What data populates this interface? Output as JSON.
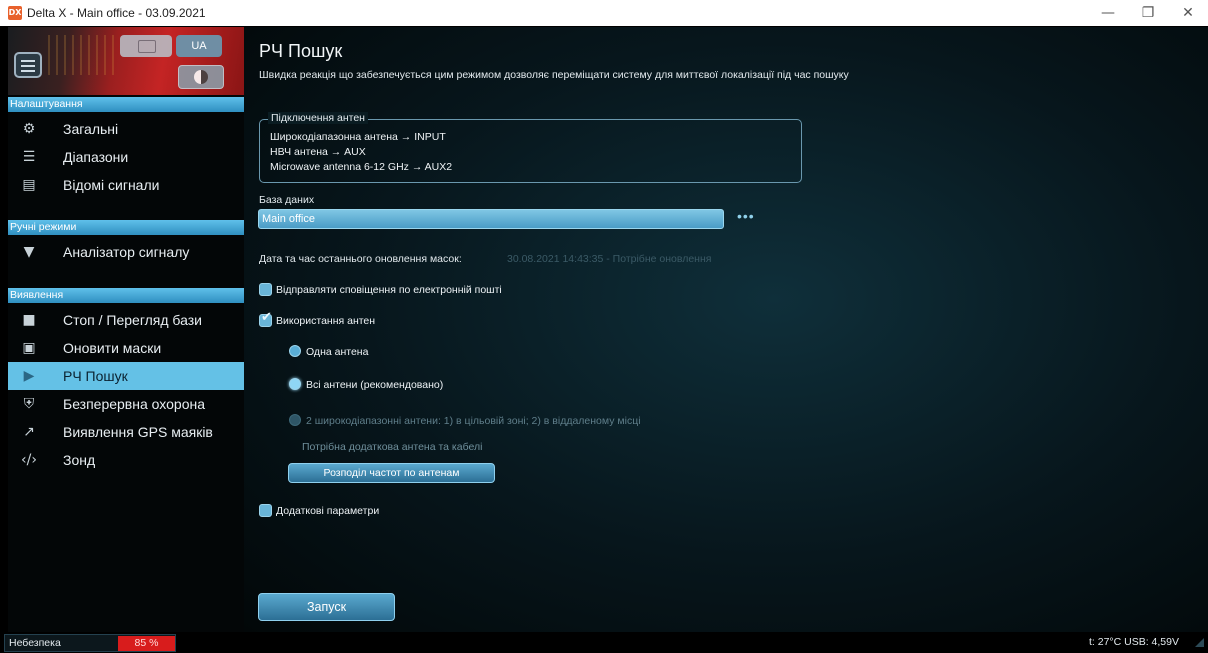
{
  "window": {
    "app_icon": "DX",
    "title": "Delta X - Main office - 03.09.2021",
    "controls": {
      "minimize": "—",
      "maximize": "❐",
      "close": "✕"
    }
  },
  "header": {
    "lang": "UA"
  },
  "sidebar": {
    "sections": [
      {
        "title": "Налаштування",
        "items": [
          {
            "label": "Загальні",
            "icon": "gear-icon"
          },
          {
            "label": "Діапазони",
            "icon": "list-icon"
          },
          {
            "label": "Відомі сигнали",
            "icon": "clipboard-icon"
          }
        ]
      },
      {
        "title": "Ручні режими",
        "items": [
          {
            "label": "Аналізатор сигналу",
            "icon": "signal-icon"
          }
        ]
      },
      {
        "title": "Виявлення",
        "items": [
          {
            "label": "Стоп / Перегляд бази",
            "icon": "stop-icon"
          },
          {
            "label": "Оновити маски",
            "icon": "image-icon"
          },
          {
            "label": "РЧ Пошук",
            "icon": "play-icon",
            "active": true
          },
          {
            "label": "Безперервна охорона",
            "icon": "shield-icon"
          },
          {
            "label": "Виявлення GPS маяків",
            "icon": "trend-icon"
          },
          {
            "label": "Зонд",
            "icon": "code-icon"
          }
        ]
      }
    ]
  },
  "main": {
    "title": "РЧ Пошук",
    "description": "Швидка реакція що забезпечується цим режимом дозволяє переміщати систему для миттєвої локалізації під час пошуку",
    "antenna_group": {
      "legend": "Підключення антен",
      "lines": [
        "Широкодіапазонна антена → INPUT",
        "НВЧ антена → AUX",
        "Microwave antenna 6-12 GHz → AUX2"
      ]
    },
    "database": {
      "label": "База даних",
      "value": "Main office",
      "more": "•••"
    },
    "mask_update": {
      "label": "Дата та час останнього оновлення масок:",
      "value": "30.08.2021 14:43:35 - Потрібне оновлення"
    },
    "email_notify": {
      "label": "Відправляти сповіщення по електронній пошті",
      "checked": false
    },
    "use_antennas": {
      "label": "Використання антен",
      "checked": true
    },
    "antenna_modes": [
      {
        "label": "Одна антена",
        "selected": false,
        "enabled": true
      },
      {
        "label": "Всі антени (рекомендовано)",
        "selected": true,
        "enabled": true
      },
      {
        "label": "2 широкодіапазонні антени: 1) в цільовій зоні; 2) в віддаленому місці",
        "selected": false,
        "enabled": false
      }
    ],
    "extra_antenna_hint": "Потрібна додаткова антена та кабелі",
    "freq_alloc_button": "Розподіл частот по антенам",
    "extra_params": {
      "label": "Додаткові параметри",
      "checked": false
    },
    "start_button": "Запуск"
  },
  "status": {
    "danger_label": "Небезпека",
    "danger_value": "85 %",
    "danger_percent": 85,
    "right_text": "t: 27°C  USB: 4,59V"
  }
}
